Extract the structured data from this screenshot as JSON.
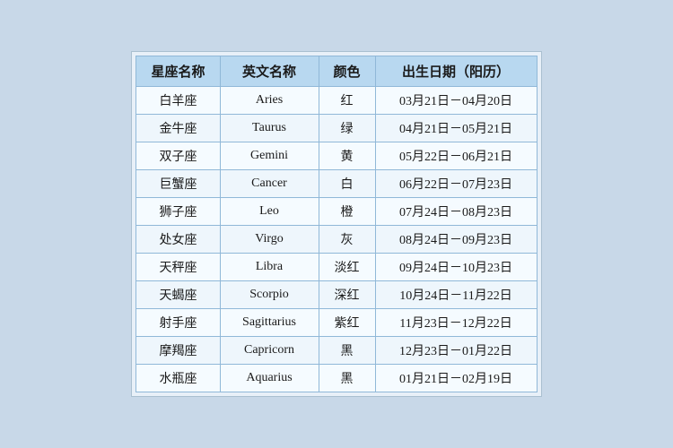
{
  "table": {
    "headers": [
      {
        "key": "zh_name",
        "label": "星座名称"
      },
      {
        "key": "en_name",
        "label": "英文名称"
      },
      {
        "key": "color",
        "label": "颜色"
      },
      {
        "key": "date_range",
        "label": "出生日期（阳历）"
      }
    ],
    "rows": [
      {
        "zh_name": "白羊座",
        "en_name": "Aries",
        "color": "红",
        "date_range": "03月21日－04月20日"
      },
      {
        "zh_name": "金牛座",
        "en_name": "Taurus",
        "color": "绿",
        "date_range": "04月21日－05月21日"
      },
      {
        "zh_name": "双子座",
        "en_name": "Gemini",
        "color": "黄",
        "date_range": "05月22日－06月21日"
      },
      {
        "zh_name": "巨蟹座",
        "en_name": "Cancer",
        "color": "白",
        "date_range": "06月22日－07月23日"
      },
      {
        "zh_name": "狮子座",
        "en_name": "Leo",
        "color": "橙",
        "date_range": "07月24日－08月23日"
      },
      {
        "zh_name": "处女座",
        "en_name": "Virgo",
        "color": "灰",
        "date_range": "08月24日－09月23日"
      },
      {
        "zh_name": "天秤座",
        "en_name": "Libra",
        "color": "淡红",
        "date_range": "09月24日－10月23日"
      },
      {
        "zh_name": "天蝎座",
        "en_name": "Scorpio",
        "color": "深红",
        "date_range": "10月24日－11月22日"
      },
      {
        "zh_name": "射手座",
        "en_name": "Sagittarius",
        "color": "紫红",
        "date_range": "11月23日－12月22日"
      },
      {
        "zh_name": "摩羯座",
        "en_name": "Capricorn",
        "color": "黑",
        "date_range": "12月23日－01月22日"
      },
      {
        "zh_name": "水瓶座",
        "en_name": "Aquarius",
        "color": "黑",
        "date_range": "01月21日－02月19日"
      }
    ]
  }
}
